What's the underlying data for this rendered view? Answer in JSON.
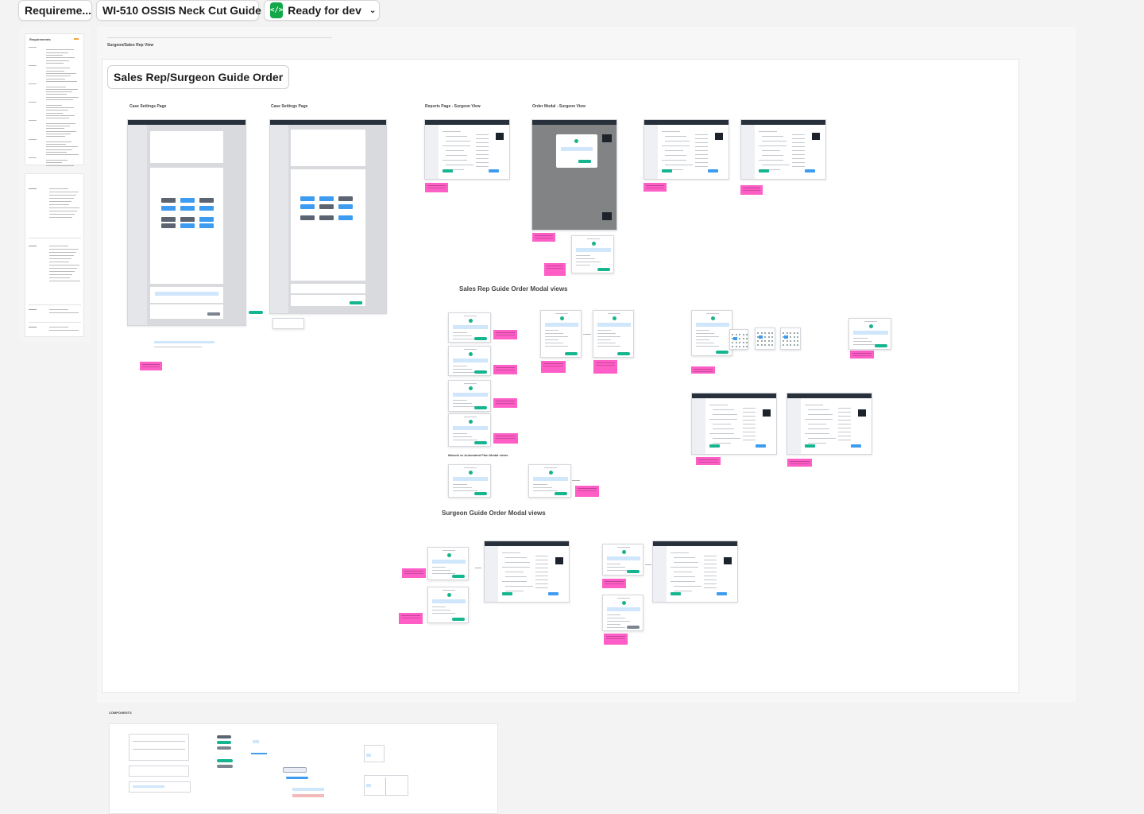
{
  "topbar": {
    "file_tab_label": "Requireme...",
    "page_tab_label": "WI-510 OSSIS Neck Cut Guide",
    "status_label": "Ready for dev",
    "status_icon": "code-icon",
    "status_chevron": "chevron-down-icon"
  },
  "requirements": {
    "label": "Requirements"
  },
  "main_section": {
    "label": "Surgeon/Sales Rep View",
    "title": "Sales Rep/Surgeon Guide Order",
    "frame_labels": [
      "Case Settings Page",
      "Case Settings Page",
      "Reports Page - Surgeon View",
      "Order Modal - Surgeon View"
    ],
    "group_headings": {
      "sales_rep": "Sales Rep Guide Order Modal views",
      "manual": "Manual vs Automated Plan Modal views",
      "surgeon": "Surgeon Guide Order Modal views"
    }
  },
  "components": {
    "label": "COMPONENTS"
  },
  "colors": {
    "canvas": "#f3f3f3",
    "sticky": "#ff5ec7",
    "status_green": "#14a84a",
    "app_header": "#27303b",
    "primary_blue": "#3d9cf0",
    "teal": "#15b58f"
  }
}
